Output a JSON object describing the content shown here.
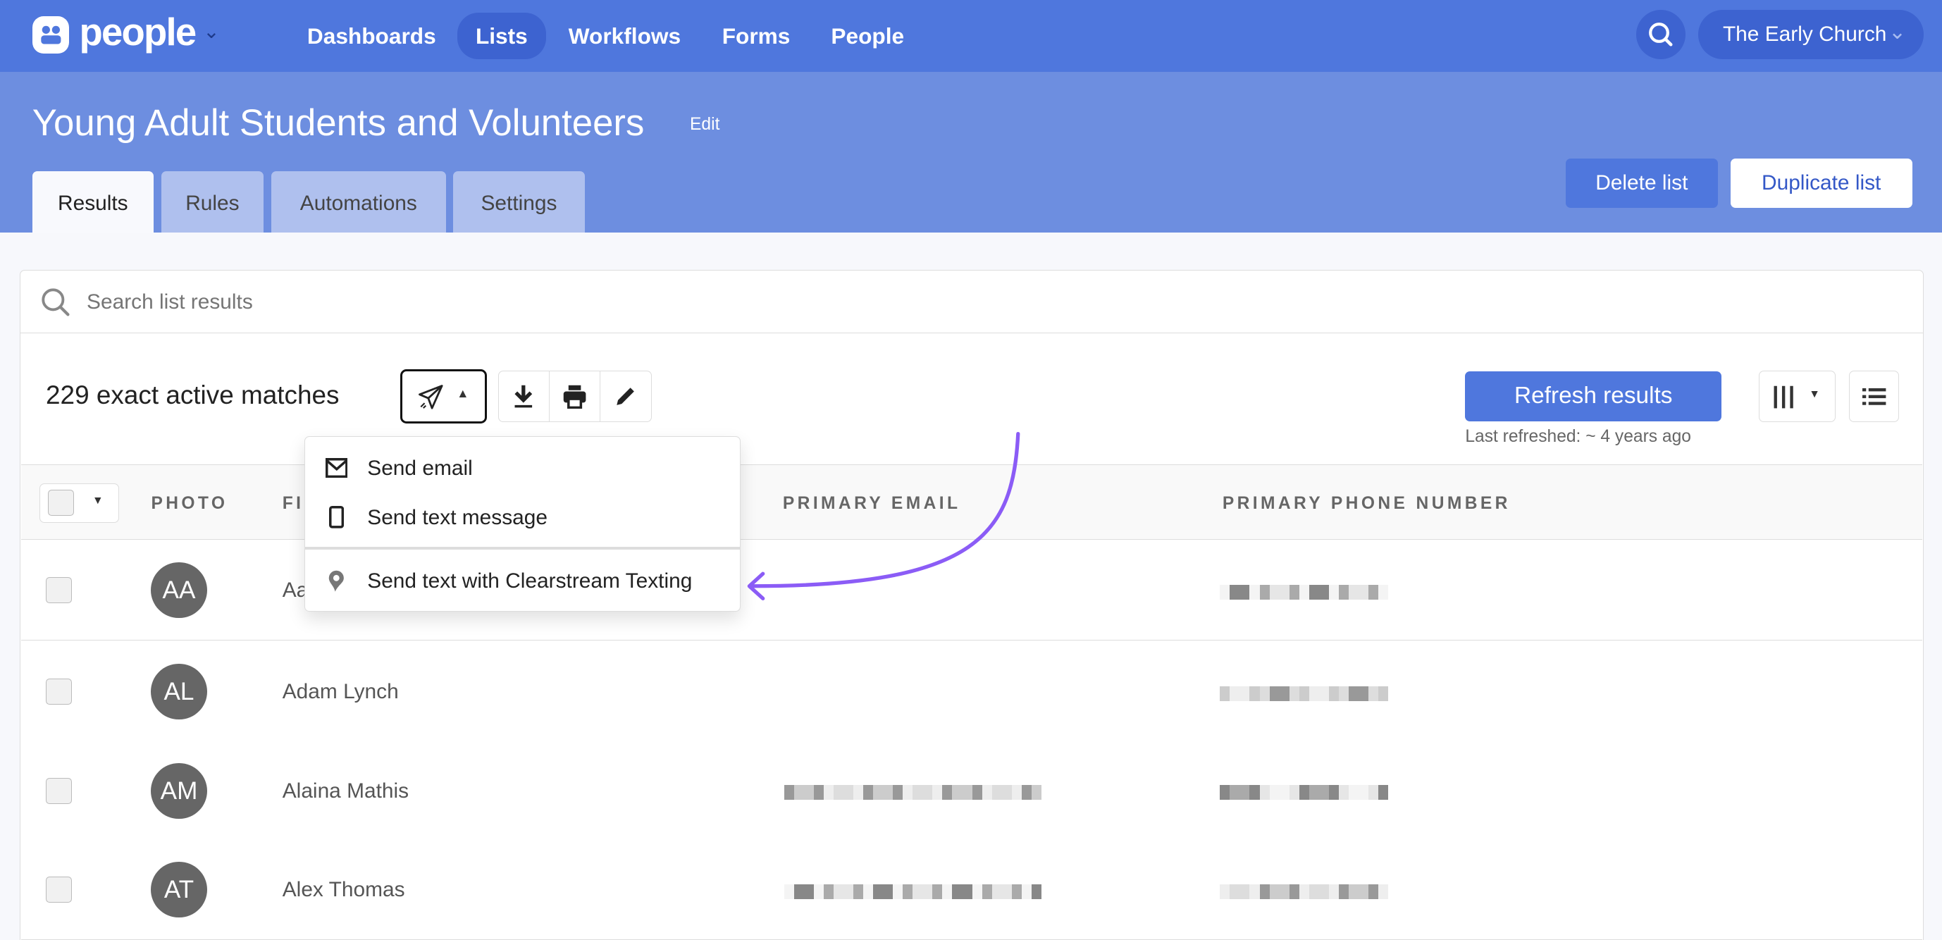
{
  "app": {
    "name": "people"
  },
  "nav": [
    {
      "label": "Dashboards",
      "active": false
    },
    {
      "label": "Lists",
      "active": true
    },
    {
      "label": "Workflows",
      "active": false
    },
    {
      "label": "Forms",
      "active": false
    },
    {
      "label": "People",
      "active": false
    }
  ],
  "org": "The Early Church",
  "header": {
    "title": "Young Adult Students and Volunteers",
    "edit": "Edit",
    "delete": "Delete list",
    "duplicate": "Duplicate list"
  },
  "tabs": [
    {
      "label": "Results"
    },
    {
      "label": "Rules"
    },
    {
      "label": "Automations"
    },
    {
      "label": "Settings"
    }
  ],
  "search": {
    "placeholder": "Search list results"
  },
  "toolbar": {
    "matches": "229 exact active matches",
    "refresh": "Refresh results",
    "last_refreshed": "Last refreshed: ~ 4 years ago"
  },
  "menu": {
    "items": [
      {
        "label": "Send email",
        "icon": "envelope-icon"
      },
      {
        "label": "Send text message",
        "icon": "mobile-icon"
      },
      {
        "label": "Send text with Clearstream Texting",
        "icon": "clearstream-icon"
      }
    ]
  },
  "columns": [
    "PHOTO",
    "FI",
    "PRIMARY EMAIL",
    "PRIMARY PHONE NUMBER"
  ],
  "rows": [
    {
      "initials": "AA",
      "name": "Aa"
    },
    {
      "initials": "AL",
      "name": "Adam Lynch"
    },
    {
      "initials": "AM",
      "name": "Alaina Mathis"
    },
    {
      "initials": "AT",
      "name": "Alex Thomas"
    }
  ],
  "colors": {
    "brand": "#4f77dd",
    "header": "#6d8ee0",
    "arrow": "#8b5cf6"
  }
}
